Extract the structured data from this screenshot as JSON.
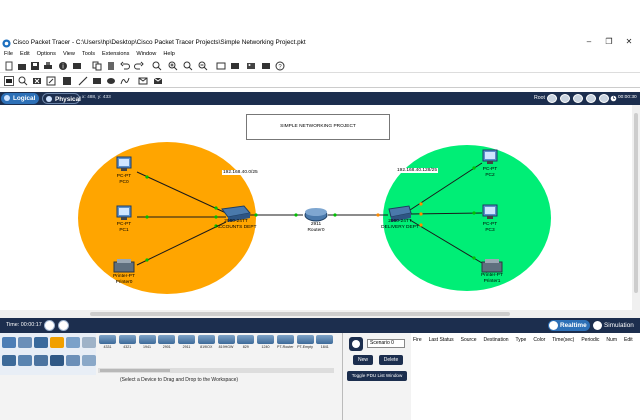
{
  "window": {
    "title": "Cisco Packet Tracer - C:\\Users\\hp\\Desktop\\Cisco Packet Tracer Projects\\Simple Networking Project.pkt",
    "minimize": "–",
    "maximize": "❐",
    "close": "✕"
  },
  "menu": [
    "File",
    "Edit",
    "Options",
    "View",
    "Tools",
    "Extensions",
    "Window",
    "Help"
  ],
  "viewbar": {
    "logical": "Logical",
    "physical": "Physical",
    "coords": "x: 488, y: 433",
    "root": "Root",
    "clock": "00:00:30"
  },
  "workspace": {
    "frame_text": "SIMPLE NETWORKING PROJECT",
    "ip_left": "192.168.40.0/25",
    "ip_right": "192.168.40.128/25",
    "devices": {
      "pc0": {
        "type": "PC-PT",
        "name": "PC0"
      },
      "pc1": {
        "type": "PC-PT",
        "name": "PC1"
      },
      "printer0": {
        "type": "Printer-PT",
        "name": "Printer0"
      },
      "sw_accounts": {
        "type": "2960-24TT",
        "name": "ACCOUNTS DEPT"
      },
      "router": {
        "type": "2911",
        "name": "Router0"
      },
      "sw_delivery": {
        "type": "2960-24TT",
        "name": "DELIVERY DEPT"
      },
      "pc2": {
        "type": "PC-PT",
        "name": "PC2"
      },
      "pc3": {
        "type": "PC-PT",
        "name": "PC3"
      },
      "printer1": {
        "type": "Printer-PT",
        "name": "Printer1"
      }
    },
    "colors": {
      "accounts_zone": "#ffa500",
      "delivery_zone": "#00ee76",
      "link": "#1a1a1a",
      "port": "#00c000",
      "port_orange": "#ff8c00"
    }
  },
  "timebar": {
    "time": "Time: 00:00:17",
    "realtime": "Realtime",
    "simulation": "Simulation"
  },
  "device_models": [
    "4331",
    "4321",
    "1941",
    "2901",
    "2911",
    "819IOX",
    "819HGW",
    "829",
    "1240",
    "PT-Router",
    "PT-Empty",
    "1841",
    "2620"
  ],
  "hint": "(Select a Device to Drag and Drop to the Workspace)",
  "pdu": {
    "scenario": "Scenario 0",
    "new": "New",
    "delete": "Delete",
    "toggle": "Toggle PDU List Window"
  },
  "pdu_table_headers": [
    "Fire",
    "Last Status",
    "Source",
    "Destination",
    "Type",
    "Color",
    "Time(sec)",
    "Periodic",
    "Num",
    "Edit"
  ]
}
